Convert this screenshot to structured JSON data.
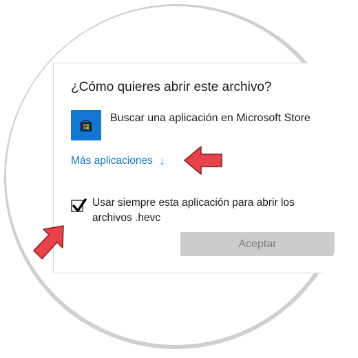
{
  "dialog": {
    "title": "¿Cómo quieres abrir este archivo?",
    "store_option_label": "Buscar una aplicación en Microsoft Store",
    "more_apps_label": "Más aplicaciones",
    "more_apps_arrow": "↓",
    "always_use_label": "Usar siempre esta aplicación para abrir los archivos .hevc",
    "always_use_checked": true,
    "accept_label": "Aceptar"
  },
  "colors": {
    "accent": "#1170cf",
    "store_tile": "#1276d3",
    "annotation_arrow": "#e8434b",
    "ring": "#cfcfcf"
  },
  "icons": {
    "store": "microsoft-store-icon",
    "check": "checkmark-icon",
    "annotation": "red-pointer-arrow"
  }
}
